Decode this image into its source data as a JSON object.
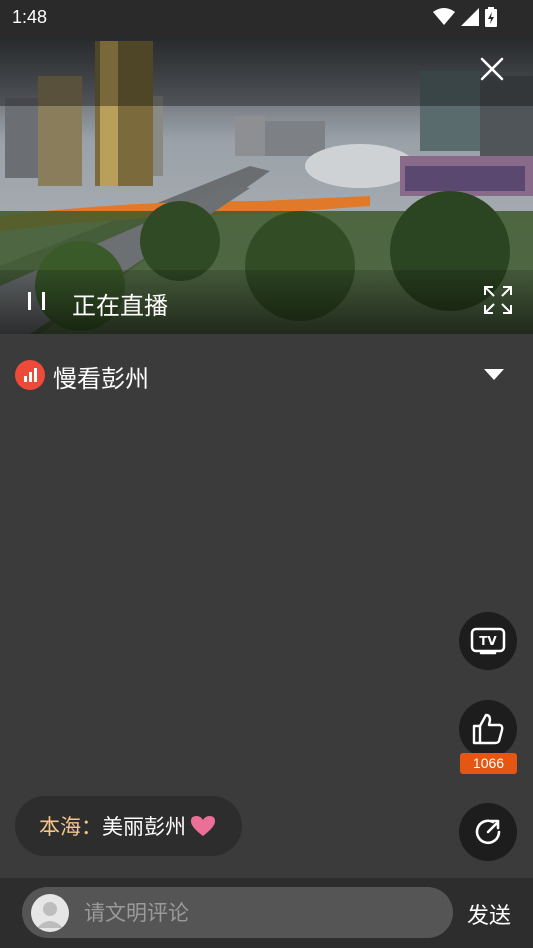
{
  "status_bar": {
    "time": "1:48"
  },
  "player": {
    "live_label": "正在直播"
  },
  "channel": {
    "name": "慢看彭州"
  },
  "actions": {
    "like_count": "1066"
  },
  "comment": {
    "user": "本海：",
    "text": "美丽彭州"
  },
  "input": {
    "placeholder": "请文明评论",
    "send_label": "发送"
  },
  "colors": {
    "accent": "#e55612",
    "channel_icon": "#ee4a3a",
    "username": "#f2c58b"
  }
}
